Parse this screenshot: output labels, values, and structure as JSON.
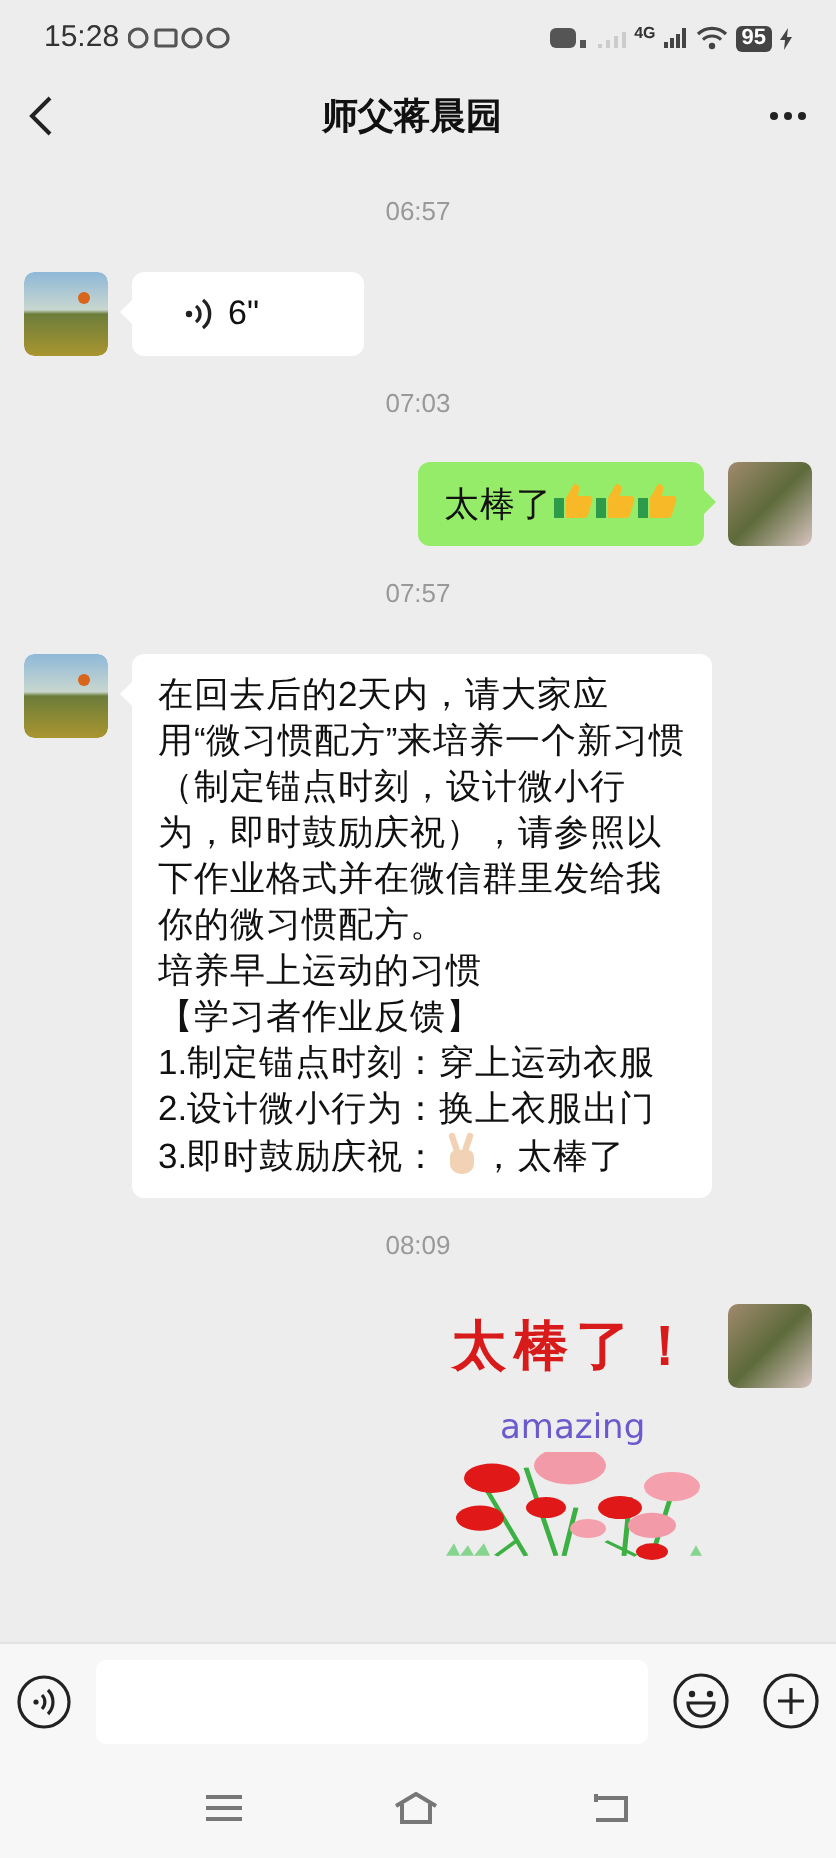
{
  "status_bar": {
    "time": "15:28",
    "network": "4G",
    "battery": "95"
  },
  "header": {
    "title": "师父蒋晨园"
  },
  "messages": [
    {
      "kind": "time",
      "text": "06:57"
    },
    {
      "kind": "voice",
      "outgoing": false,
      "duration": "6\""
    },
    {
      "kind": "time",
      "text": "07:03"
    },
    {
      "kind": "text",
      "outgoing": true,
      "lines": [
        [
          {
            "kind": "text",
            "text": "太棒了"
          },
          {
            "kind": "thumbs-up"
          },
          {
            "kind": "thumbs-up"
          },
          {
            "kind": "thumbs-up"
          }
        ]
      ]
    },
    {
      "kind": "time",
      "text": "07:57"
    },
    {
      "kind": "text",
      "outgoing": false,
      "lines": [
        [
          {
            "kind": "text",
            "text": "在回去后的2天内，请大家应用“微习惯配方”来培养一个新习惯（制定锚点时刻，设计微小行为，即时鼓励庆祝），请参照以下作业格式并在微信群里发给我你的微习惯配方。"
          }
        ],
        [
          {
            "kind": "text",
            "text": "培养早上运动的习惯"
          }
        ],
        [
          {
            "kind": "text",
            "text": "【学习者作业反馈】"
          }
        ],
        [
          {
            "kind": "text",
            "text": "1.制定锚点时刻：穿上运动衣服"
          }
        ],
        [
          {
            "kind": "text",
            "text": "2.设计微小行为：换上衣服出门"
          }
        ],
        [
          {
            "kind": "text",
            "text": "3.即时鼓励庆祝："
          },
          {
            "kind": "victory-hand"
          },
          {
            "kind": "text",
            "text": "，太棒了"
          }
        ]
      ]
    },
    {
      "kind": "time",
      "text": "08:09"
    },
    {
      "kind": "sticker",
      "outgoing": true,
      "caption": "太棒了！",
      "subcaption": "amazing"
    }
  ]
}
